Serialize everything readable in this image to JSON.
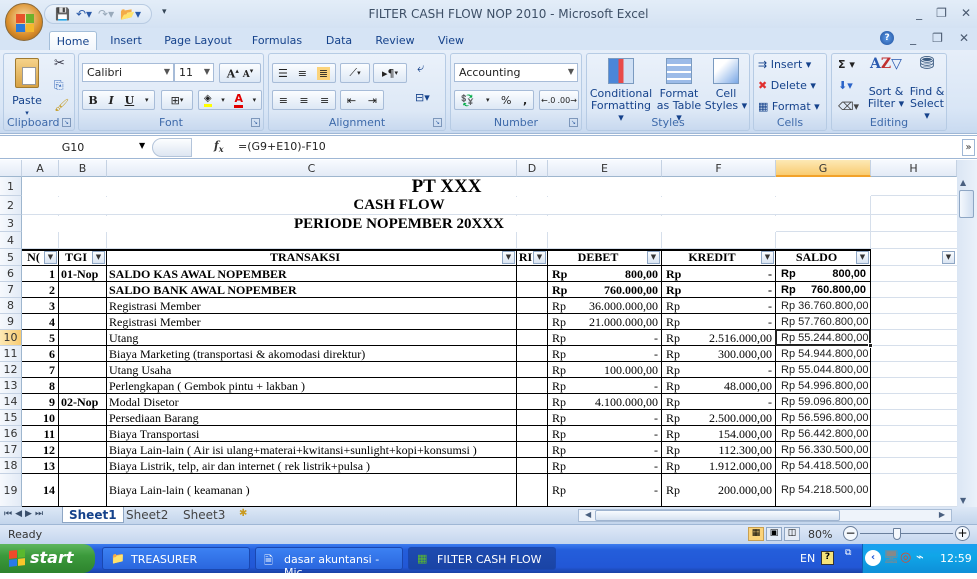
{
  "window": {
    "title": "FILTER CASH FLOW NOP 2010 - Microsoft Excel",
    "controls": [
      "minimize",
      "restore",
      "close"
    ]
  },
  "ribbon_tabs": [
    "Home",
    "Insert",
    "Page Layout",
    "Formulas",
    "Data",
    "Review",
    "View"
  ],
  "active_tab": "Home",
  "ribbon": {
    "clipboard": {
      "label": "Clipboard",
      "paste": "Paste"
    },
    "font": {
      "label": "Font",
      "font_name": "Calibri",
      "font_size": "11",
      "bold": "B",
      "italic": "I",
      "underline": "U"
    },
    "alignment": {
      "label": "Alignment"
    },
    "number": {
      "label": "Number",
      "format": "Accounting",
      "percent": "%",
      "comma": ",",
      "inc_decimal": ".0→.00",
      "dec_decimal": ".00→.0"
    },
    "styles": {
      "label": "Styles",
      "conditional_formatting": [
        "Conditional",
        "Formatting ▾"
      ],
      "format_as_table": [
        "Format",
        "as Table ▾"
      ],
      "cell_styles": [
        "Cell",
        "Styles ▾"
      ]
    },
    "cells": {
      "label": "Cells",
      "insert": "Insert ▾",
      "delete": "Delete ▾",
      "format": "Format ▾"
    },
    "editing": {
      "label": "Editing",
      "autosum": "Σ ▾",
      "sort_filter": [
        "Sort &",
        "Filter ▾"
      ],
      "find_select": [
        "Find &",
        "Select ▾"
      ]
    }
  },
  "formula_bar": {
    "name_box": "G10",
    "fx": "fx",
    "formula": "=(G9+E10)-F10"
  },
  "columns": [
    "A",
    "B",
    "C",
    "D",
    "E",
    "F",
    "G",
    "H"
  ],
  "selected_column": "G",
  "selected_row": 10,
  "sheet": {
    "title1": "PT XXX",
    "title2": "CASH FLOW",
    "title3": "PERIODE NOPEMBER 20XXX",
    "headers": {
      "no": "N(",
      "tgl": "TGI",
      "transaksi": "TRANSAKSI",
      "ref": "RI",
      "debet": "DEBET",
      "kredit": "KREDIT",
      "saldo": "SALDO"
    },
    "rows": [
      {
        "row": 6,
        "no": "1",
        "tgl": "01-Nop",
        "transaksi": "SALDO KAS AWAL NOPEMBER",
        "debet": "800,00",
        "kredit": "-",
        "saldo": "800,00",
        "bold": true
      },
      {
        "row": 7,
        "no": "2",
        "tgl": "",
        "transaksi": "SALDO BANK AWAL NOPEMBER",
        "debet": "760.000,00",
        "kredit": "-",
        "saldo": "760.800,00",
        "bold": true
      },
      {
        "row": 8,
        "no": "3",
        "tgl": "",
        "transaksi": "Registrasi Member",
        "debet": "36.000.000,00",
        "kredit": "-",
        "saldo": "Rp 36.760.800,00"
      },
      {
        "row": 9,
        "no": "4",
        "tgl": "",
        "transaksi": "Registrasi Member",
        "debet": "21.000.000,00",
        "kredit": "-",
        "saldo": "Rp 57.760.800,00"
      },
      {
        "row": 10,
        "no": "5",
        "tgl": "",
        "transaksi": "Utang",
        "debet": "-",
        "kredit": "2.516.000,00",
        "saldo": "Rp 55.244.800,00"
      },
      {
        "row": 11,
        "no": "6",
        "tgl": "",
        "transaksi": "Biaya Marketing (transportasi & akomodasi direktur)",
        "debet": "-",
        "kredit": "300.000,00",
        "saldo": "Rp 54.944.800,00"
      },
      {
        "row": 12,
        "no": "7",
        "tgl": "",
        "transaksi": "Utang Usaha",
        "debet": "100.000,00",
        "kredit": "-",
        "saldo": "Rp 55.044.800,00"
      },
      {
        "row": 13,
        "no": "8",
        "tgl": "",
        "transaksi": "Perlengkapan ( Gembok pintu + lakban )",
        "debet": "-",
        "kredit": "48.000,00",
        "saldo": "Rp 54.996.800,00"
      },
      {
        "row": 14,
        "no": "9",
        "tgl": "02-Nop",
        "transaksi": "Modal Disetor",
        "debet": "4.100.000,00",
        "kredit": "-",
        "saldo": "Rp 59.096.800,00"
      },
      {
        "row": 15,
        "no": "10",
        "tgl": "",
        "transaksi": "Persediaan Barang",
        "debet": "-",
        "kredit": "2.500.000,00",
        "saldo": "Rp 56.596.800,00"
      },
      {
        "row": 16,
        "no": "11",
        "tgl": "",
        "transaksi": "Biaya Transportasi",
        "debet": "-",
        "kredit": "154.000,00",
        "saldo": "Rp 56.442.800,00"
      },
      {
        "row": 17,
        "no": "12",
        "tgl": "",
        "transaksi": "Biaya Lain-lain ( Air isi ulang+materai+kwitansi+sunlight+kopi+konsumsi )",
        "debet": "-",
        "kredit": "112.300,00",
        "saldo": "Rp 56.330.500,00"
      },
      {
        "row": 18,
        "no": "13",
        "tgl": "",
        "transaksi": "Biaya Listrik, telp, air dan internet ( rek listrik+pulsa )",
        "debet": "-",
        "kredit": "1.912.000,00",
        "saldo": "Rp 54.418.500,00"
      },
      {
        "row": 19,
        "no": "14",
        "tgl": "",
        "transaksi": "Biaya Lain-lain ( keamanan )",
        "debet": "-",
        "kredit": "200.000,00",
        "saldo": "Rp 54.218.500,00"
      }
    ],
    "currency": "Rp"
  },
  "sheet_tabs": [
    "Sheet1",
    "Sheet2",
    "Sheet3"
  ],
  "active_sheet": "Sheet1",
  "status": {
    "ready": "Ready",
    "zoom": "80%"
  },
  "taskbar": {
    "start": "start",
    "items": [
      {
        "label": "TREASURER",
        "icon": "folder-icon"
      },
      {
        "label": "dasar akuntansi - Mic...",
        "icon": "word-icon"
      },
      {
        "label": "FILTER CASH FLOW ...",
        "icon": "excel-icon",
        "active": true
      }
    ],
    "lang": "EN",
    "clock": "12:59"
  }
}
